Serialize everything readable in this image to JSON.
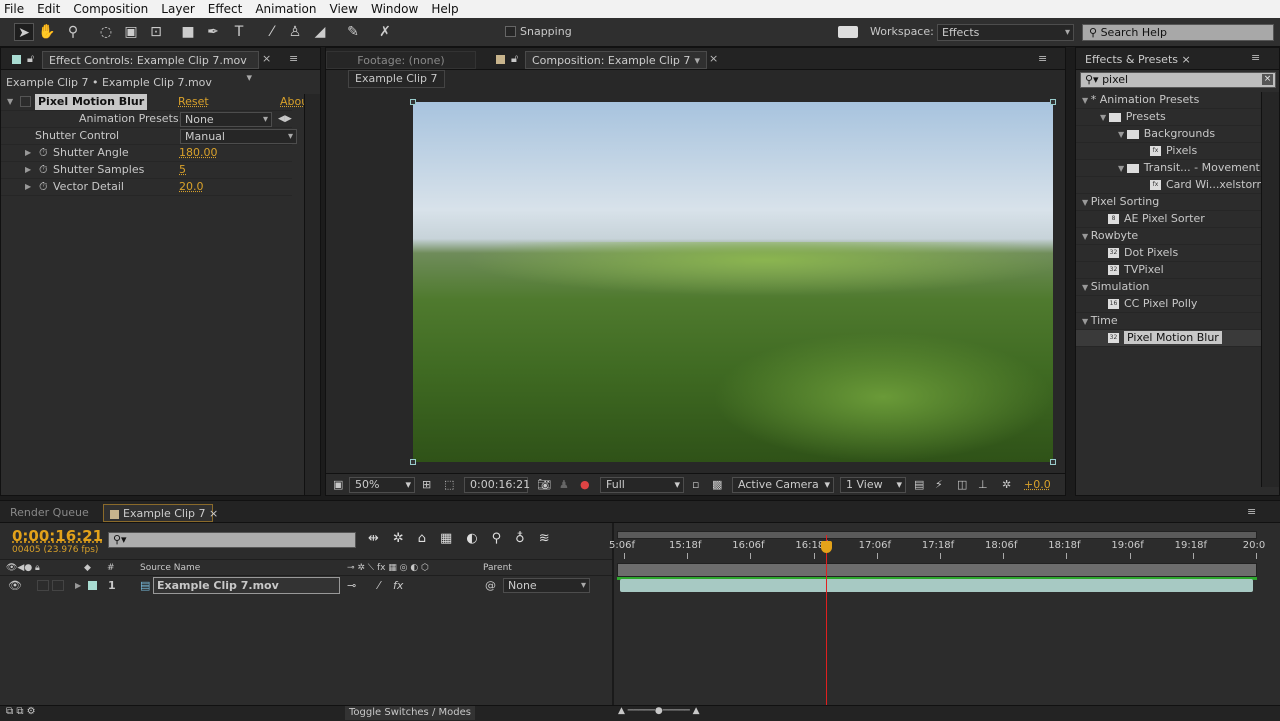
{
  "menu": [
    "File",
    "Edit",
    "Composition",
    "Layer",
    "Effect",
    "Animation",
    "View",
    "Window",
    "Help"
  ],
  "toolbar": {
    "snapping": "Snapping",
    "workspace_label": "Workspace:",
    "workspace_value": "Effects",
    "search_help": "Search Help"
  },
  "effect_controls": {
    "tab": "Effect Controls: Example Clip 7.mov",
    "breadcrumb": "Example Clip 7 • Example Clip 7.mov",
    "effect_name": "Pixel Motion Blur",
    "reset": "Reset",
    "about": "Abou",
    "presets_label": "Animation Presets:",
    "presets_value": "None",
    "shutter_control_label": "Shutter Control",
    "shutter_control_value": "Manual",
    "params": [
      {
        "name": "Shutter Angle",
        "value": "180.00"
      },
      {
        "name": "Shutter Samples",
        "value": "5"
      },
      {
        "name": "Vector Detail",
        "value": "20.0"
      }
    ]
  },
  "viewer": {
    "footage_tab": "Footage: (none)",
    "comp_tab": "Composition: Example Clip 7",
    "comp_crumb": "Example Clip 7",
    "zoom": "50%",
    "timecode": "0:00:16:21",
    "resolution": "Full",
    "camera": "Active Camera",
    "views": "1 View",
    "exposure": "+0.0"
  },
  "effects_presets": {
    "tab": "Effects & Presets",
    "search": "pixel",
    "items": [
      {
        "label": "* Animation Presets",
        "type": "cat",
        "level": 0
      },
      {
        "label": "Presets",
        "type": "folder",
        "level": 1
      },
      {
        "label": "Backgrounds",
        "type": "folder",
        "level": 2
      },
      {
        "label": "Pixels",
        "type": "preset",
        "level": 3
      },
      {
        "label": "Transit... - Movement",
        "type": "folder",
        "level": 2
      },
      {
        "label": "Card Wi...xelstorm",
        "type": "preset",
        "level": 3
      },
      {
        "label": "Pixel Sorting",
        "type": "cat",
        "level": 0
      },
      {
        "label": "AE Pixel Sorter",
        "type": "effect",
        "level": 1,
        "bits": "8"
      },
      {
        "label": "Rowbyte",
        "type": "cat",
        "level": 0
      },
      {
        "label": "Dot Pixels",
        "type": "effect",
        "level": 1,
        "bits": "32"
      },
      {
        "label": "TVPixel",
        "type": "effect",
        "level": 1,
        "bits": "32"
      },
      {
        "label": "Simulation",
        "type": "cat",
        "level": 0
      },
      {
        "label": "CC Pixel Polly",
        "type": "effect",
        "level": 1,
        "bits": "16"
      },
      {
        "label": "Time",
        "type": "cat",
        "level": 0
      },
      {
        "label": "Pixel Motion Blur",
        "type": "effect",
        "level": 1,
        "bits": "32",
        "selected": true
      }
    ]
  },
  "timeline": {
    "render_queue_tab": "Render Queue",
    "comp_tab": "Example Clip 7",
    "timecode": "0:00:16:21",
    "frame_info": "00405 (23.976 fps)",
    "columns": {
      "num": "#",
      "source": "Source Name",
      "parent": "Parent"
    },
    "layer": {
      "num": "1",
      "name": "Example Clip 7.mov",
      "parent": "None"
    },
    "ruler": [
      "5:06f",
      "15:18f",
      "16:06f",
      "16:18f",
      "17:06f",
      "17:18f",
      "18:06f",
      "18:18f",
      "19:06f",
      "19:18f",
      "20:0"
    ],
    "toggle": "Toggle Switches / Modes",
    "playhead_fraction": 0.33
  }
}
